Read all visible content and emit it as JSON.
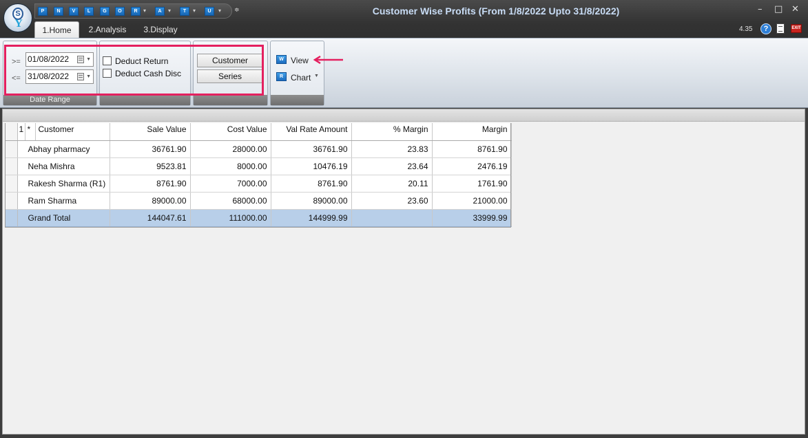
{
  "window": {
    "title": "Customer Wise Profits (From 1/8/2022 Upto 31/8/2022)",
    "minimize": "–",
    "maximize": "□",
    "close": "✕"
  },
  "quick_access": [
    "P",
    "N",
    "V",
    "L",
    "G",
    "O",
    "R",
    "A",
    "T",
    "U"
  ],
  "tabs": [
    "1.Home",
    "2.Analysis",
    "3.Display"
  ],
  "version": "4.35",
  "ribbon": {
    "date_range": {
      "from_op": ">=",
      "from_value": "01/08/2022",
      "to_op": "<=",
      "to_value": "31/08/2022",
      "label": "Date Range"
    },
    "options": {
      "deduct_return": "Deduct Return",
      "deduct_cash_disc": "Deduct Cash Disc"
    },
    "buttons": {
      "customer": "Customer",
      "series": "Series"
    },
    "actions": {
      "view": "View",
      "chart": "Chart"
    }
  },
  "grid": {
    "header": {
      "index": "1",
      "star": "*",
      "columns": [
        "Customer",
        "Sale Value",
        "Cost Value",
        "Val Rate Amount",
        "% Margin",
        "Margin"
      ]
    },
    "rows": [
      [
        "Abhay pharmacy",
        "36761.90",
        "28000.00",
        "36761.90",
        "23.83",
        "8761.90"
      ],
      [
        "Neha Mishra",
        "9523.81",
        "8000.00",
        "10476.19",
        "23.64",
        "2476.19"
      ],
      [
        "Rakesh Sharma (R1)",
        "8761.90",
        "7000.00",
        "8761.90",
        "20.11",
        "1761.90"
      ],
      [
        "Ram Sharma",
        "89000.00",
        "68000.00",
        "89000.00",
        "23.60",
        "21000.00"
      ]
    ],
    "total": [
      "Grand Total",
      "144047.61",
      "111000.00",
      "144999.99",
      "",
      "33999.99"
    ]
  },
  "colors": {
    "highlight_box": "#e4205f",
    "total_row": "#b8cfe9",
    "title_text": "#c8dcf5"
  }
}
